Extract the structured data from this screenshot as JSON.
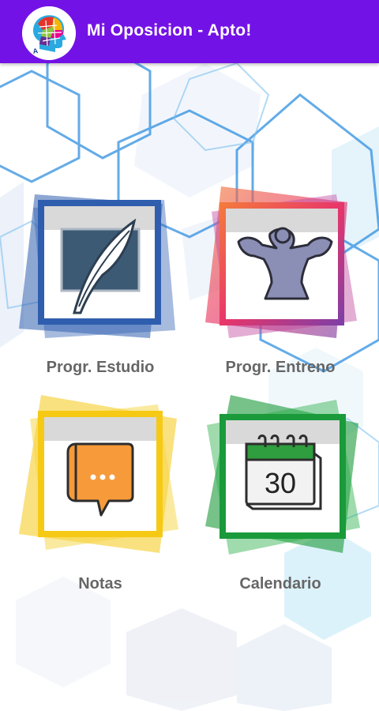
{
  "app": {
    "title": "Mi Oposicion - Apto!"
  },
  "colors": {
    "appbar": "#7312e6",
    "estudio": "#2f5eae",
    "entreno_start": "#f47c3c",
    "entreno_end": "#7b3fa8",
    "notas": "#f6c915",
    "calendario": "#1a9a3a",
    "label": "#666666"
  },
  "menu": {
    "estudio": {
      "label": "Progr. Estudio",
      "icon": "quill-icon"
    },
    "entreno": {
      "label": "Progr. Entreno",
      "icon": "muscle-icon"
    },
    "notas": {
      "label": "Notas",
      "icon": "notebook-icon"
    },
    "calendario": {
      "label": "Calendario",
      "icon": "calendar-icon",
      "day": "30"
    }
  }
}
